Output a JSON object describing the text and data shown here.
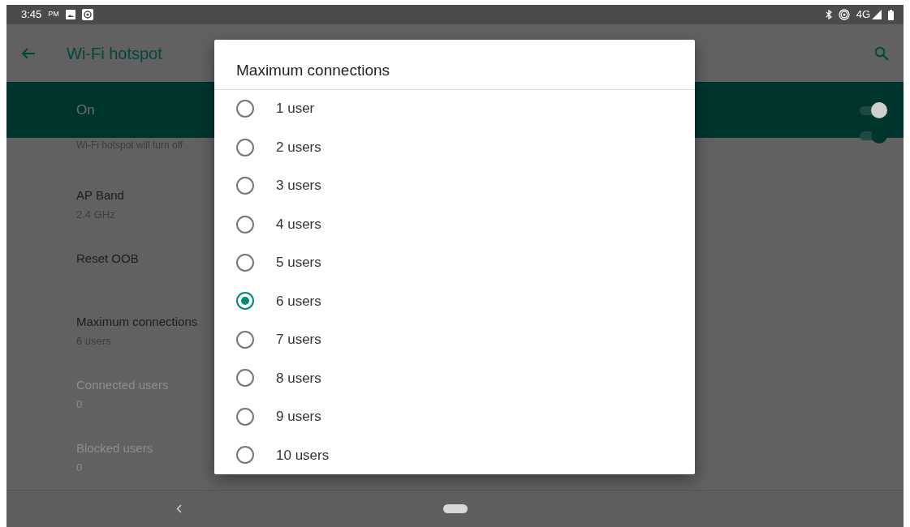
{
  "status_bar": {
    "time": "3:45",
    "ampm": "PM",
    "network": "4G"
  },
  "app_bar": {
    "title": "Wi-Fi hotspot"
  },
  "master_switch": {
    "label": "On",
    "on": true
  },
  "settings": [
    {
      "kind": "summary_switch",
      "summary": "Wi-Fi hotspot will turn off",
      "on": true
    },
    {
      "kind": "item",
      "title": "AP Band",
      "summary": "2.4 GHz",
      "disabled": false
    },
    {
      "kind": "item",
      "title": "Reset OOB",
      "disabled": false
    },
    {
      "kind": "item",
      "title": "Maximum connections",
      "summary": "6 users",
      "disabled": false
    },
    {
      "kind": "item",
      "title": "Connected users",
      "summary": "0",
      "disabled": true
    },
    {
      "kind": "item",
      "title": "Blocked users",
      "summary": "0",
      "disabled": true
    }
  ],
  "dialog": {
    "title": "Maximum connections",
    "options": [
      {
        "label": "1 user",
        "selected": false
      },
      {
        "label": "2 users",
        "selected": false
      },
      {
        "label": "3 users",
        "selected": false
      },
      {
        "label": "4 users",
        "selected": false
      },
      {
        "label": "5 users",
        "selected": false
      },
      {
        "label": "6 users",
        "selected": true
      },
      {
        "label": "7 users",
        "selected": false
      },
      {
        "label": "8 users",
        "selected": false
      },
      {
        "label": "9 users",
        "selected": false
      },
      {
        "label": "10 users",
        "selected": false
      }
    ]
  }
}
